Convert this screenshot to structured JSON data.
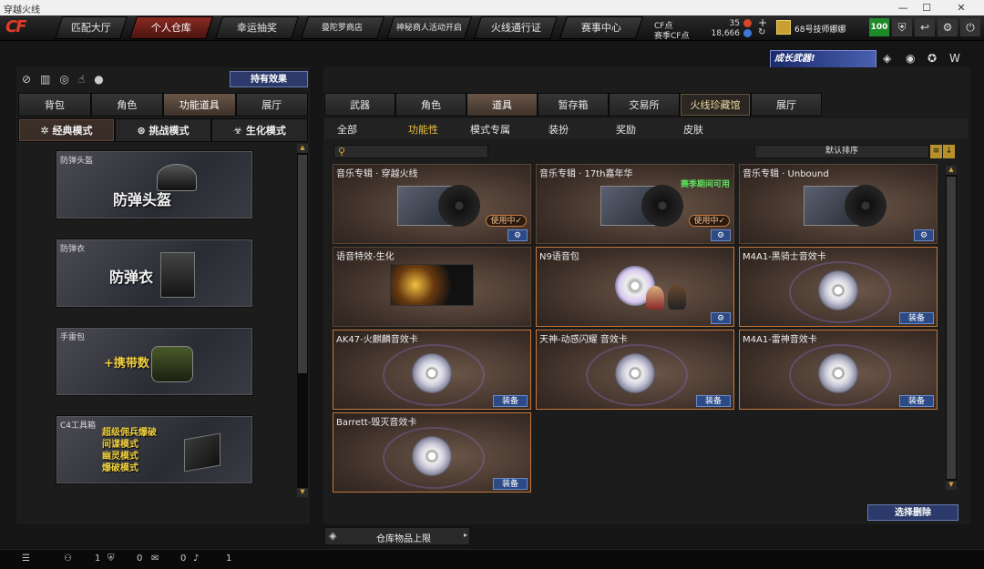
{
  "window": {
    "title": "穿越火线"
  },
  "logo": "CF",
  "nav": {
    "tabs": [
      "匹配大厅",
      "个人仓库",
      "幸运抽奖",
      "曼陀罗商店",
      "神秘商人活动开启",
      "火线通行证",
      "赛事中心"
    ],
    "cf_label": "CF点",
    "cf_value": "35",
    "season_cf_label": "赛季CF点",
    "season_cf_value": "18,666",
    "rank_name": "68号技师娜娜",
    "level": "100"
  },
  "left": {
    "own_effects_button": "持有效果",
    "top_tabs": [
      "背包",
      "角色",
      "功能道具",
      "展厅"
    ],
    "mode_tabs": [
      "经典模式",
      "挑战模式",
      "生化模式"
    ],
    "items": [
      {
        "small": "防弹头盔",
        "big": "防弹头盔"
      },
      {
        "small": "防弹衣",
        "big": "防弹衣"
      },
      {
        "small": "手雷包",
        "big": "+携带数"
      },
      {
        "small": "C4工具箱",
        "lines": [
          "超级佣兵爆破",
          "间谍模式",
          "幽灵模式",
          "爆破模式"
        ]
      }
    ]
  },
  "right": {
    "top_tabs": [
      "武器",
      "角色",
      "道具",
      "暂存箱",
      "交易所",
      "火线珍藏馆",
      "展厅"
    ],
    "sub_tabs": [
      "全部",
      "功能性",
      "模式专属",
      "装扮",
      "奖励",
      "皮肤"
    ],
    "sort_label": "默认排序",
    "banner_text": "成长武器!",
    "cards": [
      {
        "title": "音乐专辑 · 穿越火线",
        "kind": "album",
        "in_use": "使用中✓"
      },
      {
        "title": "音乐专辑 · 17th嘉年华",
        "kind": "album",
        "in_use": "使用中✓",
        "note": "赛季期间可用"
      },
      {
        "title": "音乐专辑 · Unbound",
        "kind": "album"
      },
      {
        "title": "语音特效-生化",
        "kind": "voice"
      },
      {
        "title": "N9语音包",
        "kind": "n9"
      },
      {
        "title": "M4A1-黑骑士音效卡",
        "kind": "sound",
        "equip": "装备"
      },
      {
        "title": "AK47-火麒麟音效卡",
        "kind": "sound",
        "equip": "装备"
      },
      {
        "title": "天神-动感闪耀 音效卡",
        "kind": "sound",
        "equip": "装备"
      },
      {
        "title": "M4A1-雷神音效卡",
        "kind": "sound",
        "equip": "装备"
      },
      {
        "title": "Barrett-毁灭音效卡",
        "kind": "sound",
        "equip": "装备"
      }
    ],
    "delete_button": "选择删除"
  },
  "capacity_label": "仓库物品上限",
  "status": {
    "a": "1",
    "b": "0",
    "c": "0",
    "d": "1"
  }
}
